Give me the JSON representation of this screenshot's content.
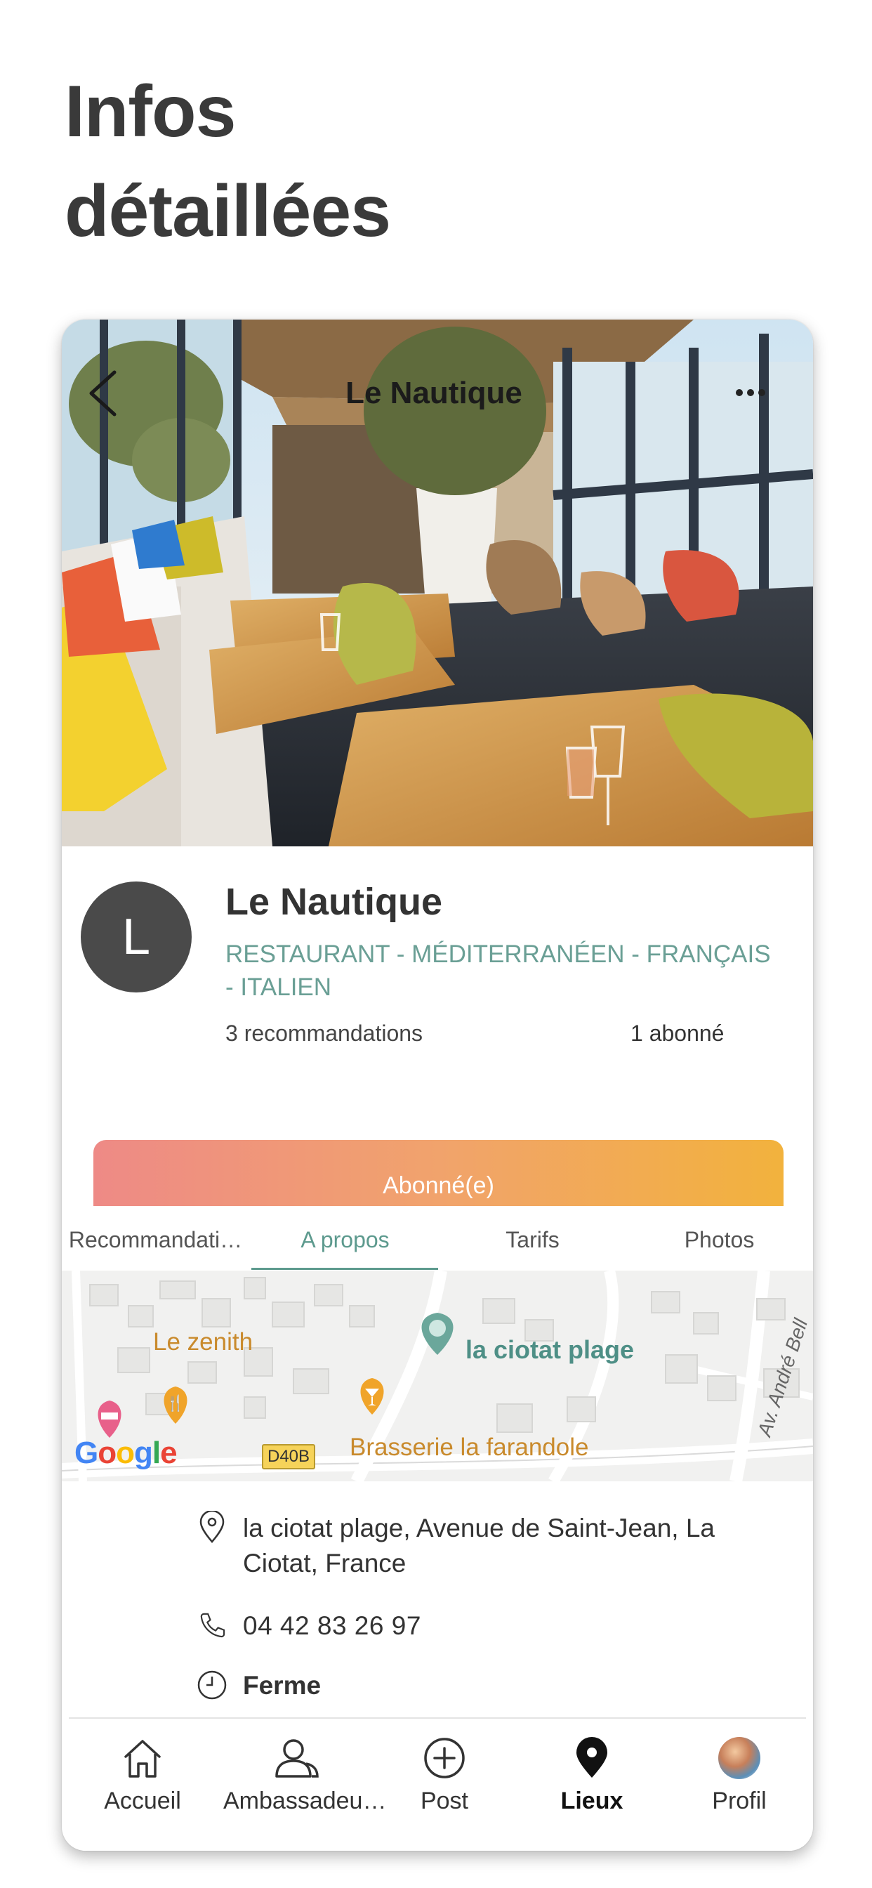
{
  "page": {
    "title": "Infos\ndétaillées"
  },
  "top_bar": {
    "title": "Le Nautique",
    "back_icon": "chevron-left-icon",
    "more_icon": "more-dots-icon"
  },
  "place": {
    "avatar_letter": "L",
    "name": "Le Nautique",
    "categories": "RESTAURANT - MÉDITERRANÉEN - FRANÇAIS - ITALIEN",
    "recommendations": "3 recommandations",
    "followers": "1 abonné"
  },
  "follow_button": {
    "label": "Abonné(e)"
  },
  "tabs": [
    {
      "label": "Recommandati…"
    },
    {
      "label": "A propos",
      "active": true
    },
    {
      "label": "Tarifs"
    },
    {
      "label": "Photos"
    }
  ],
  "map": {
    "labels": {
      "zenith": "Le zenith",
      "plage": "la ciotat plage",
      "brasserie": "Brasserie la farandole",
      "road": "Av. André Bell",
      "road_badge": "D40B"
    },
    "attribution": "Google"
  },
  "details": {
    "address": "la ciotat plage, Avenue de Saint-Jean, La Ciotat, France",
    "phone": "04 42 83 26 97",
    "hours_status": "Ferme"
  },
  "bottom_nav": [
    {
      "label": "Accueil",
      "icon": "home-icon"
    },
    {
      "label": "Ambassadeu…",
      "icon": "users-icon"
    },
    {
      "label": "Post",
      "icon": "plus-circle-icon"
    },
    {
      "label": "Lieux",
      "icon": "map-pin-icon",
      "active": true
    },
    {
      "label": "Profil",
      "icon": "profile-avatar"
    }
  ],
  "colors": {
    "accent": "#5d9a8e",
    "gradient_start": "#ee8a86",
    "gradient_end": "#f2b23d",
    "avatar_bg": "#4a4a4a"
  }
}
